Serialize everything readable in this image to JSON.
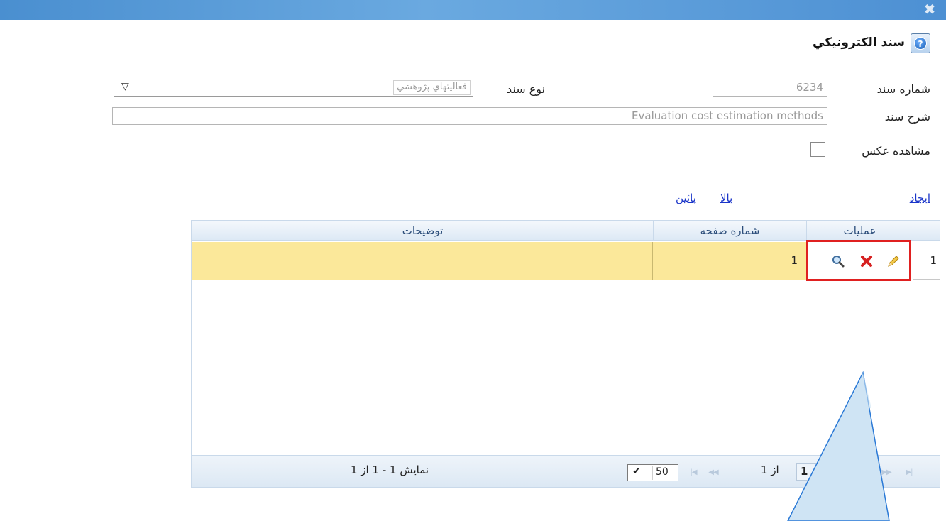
{
  "window": {
    "close_icon": "close-x-icon"
  },
  "header": {
    "title": "سند الکترونيکي",
    "help_icon": "help-icon"
  },
  "form": {
    "doc_number_label": "شماره سند",
    "doc_number_value": "6234",
    "doc_type_label": "نوع سند",
    "doc_type_value": "فعاليتهاي پژوهشي",
    "doc_desc_label": "شرح سند",
    "doc_desc_value": "Evaluation cost estimation methods",
    "view_image_label": "مشاهده عکس"
  },
  "links": {
    "create": "ايجاد",
    "up": "بالا",
    "down": "پائين"
  },
  "grid": {
    "columns": [
      "عمليات",
      "شماره صفحه",
      "توضيحات"
    ],
    "rows": [
      {
        "index": "1",
        "page_number": "1",
        "description": ""
      }
    ],
    "row_icons": [
      "edit-pencil-icon",
      "delete-x-icon",
      "view-magnifier-icon"
    ]
  },
  "pager": {
    "info": "نمايش 1 - 1 از 1",
    "page_size": "50",
    "of_label": "از 1",
    "current_page": "1"
  }
}
